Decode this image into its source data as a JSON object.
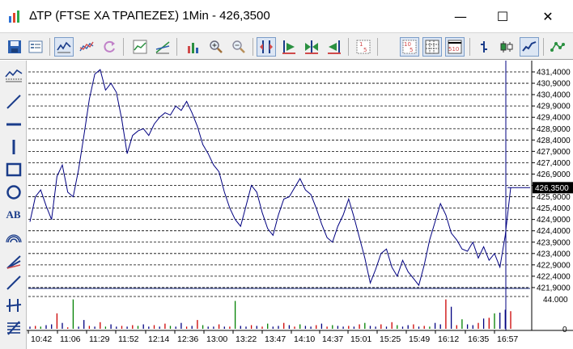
{
  "window": {
    "title": "ΔΤΡ (FTSE ΧΑ ΤΡΑΠΕΖΕΣ) 1Min - 426,3500",
    "minimize_glyph": "—",
    "maximize_glyph": "☐",
    "close_glyph": "✕"
  },
  "toolbar": {
    "buttons": [
      {
        "name": "save-icon",
        "pressed": false
      },
      {
        "name": "list-icon",
        "pressed": false
      },
      {
        "name": "line-chart-toggle-icon",
        "pressed": true
      },
      {
        "name": "refresh-icon",
        "pressed": false
      },
      {
        "name": "chart-type-icon",
        "pressed": false
      },
      {
        "name": "trend-icon",
        "pressed": false
      },
      {
        "name": "bar-volume-icon",
        "pressed": false
      },
      {
        "name": "zoom-in-icon",
        "pressed": false
      },
      {
        "name": "zoom-out-icon",
        "pressed": false
      },
      {
        "name": "crosshair-icon",
        "pressed": true
      },
      {
        "name": "scroll-right-icon",
        "pressed": false
      },
      {
        "name": "scroll-both-icon",
        "pressed": false
      },
      {
        "name": "scroll-left-icon",
        "pressed": false
      },
      {
        "name": "interval-1-icon",
        "pressed": false
      },
      {
        "name": "interval-10-icon",
        "pressed": true
      },
      {
        "name": "grid-icon",
        "pressed": true
      },
      {
        "name": "interval-510-icon",
        "pressed": true
      },
      {
        "name": "bar-style-icon",
        "pressed": false
      },
      {
        "name": "candle-style-icon",
        "pressed": false
      },
      {
        "name": "line-style-icon",
        "pressed": true
      },
      {
        "name": "indicator-icon",
        "pressed": false
      }
    ]
  },
  "sidebar": {
    "tools": [
      "chart-overview-icon",
      "trendline-icon",
      "horizontal-line-icon",
      "vertical-line-icon",
      "rectangle-icon",
      "ellipse-icon",
      "text-tool-icon",
      "arc-icon",
      "fibonacci-fan-icon",
      "channel-icon",
      "speed-lines-icon",
      "fibonacci-retracement-icon"
    ],
    "text_tool_label": "AB"
  },
  "chart_data": {
    "type": "line",
    "title": "",
    "price_axis_labels": [
      "431,4000",
      "430,9000",
      "430,4000",
      "429,9000",
      "429,4000",
      "428,9000",
      "428,4000",
      "427,9000",
      "427,4000",
      "426,9000",
      "426,4000",
      "425,9000",
      "425,4000",
      "424,9000",
      "424,4000",
      "423,9000",
      "423,4000",
      "422,9000",
      "422,4000",
      "421,9000"
    ],
    "volume_axis_labels": [
      "44.000",
      "0"
    ],
    "x_tick_labels": [
      "10:42",
      "11:06",
      "11:29",
      "11:52",
      "12:14",
      "12:36",
      "13:00",
      "13:22",
      "13:47",
      "14:10",
      "14:37",
      "15:01",
      "15:25",
      "15:49",
      "16:12",
      "16:35",
      "16:57"
    ],
    "current_value_label": "426,3500",
    "ylim": [
      421.6,
      431.7
    ],
    "grid": true,
    "series": [
      {
        "values": [
          424.8,
          425.9,
          426.2,
          425.5,
          424.9,
          426.8,
          427.3,
          426.1,
          425.9,
          427.1,
          428.6,
          430.2,
          431.3,
          431.5,
          430.6,
          430.9,
          430.5,
          429.3,
          427.8,
          428.6,
          428.8,
          428.9,
          428.6,
          429.1,
          429.4,
          429.6,
          429.5,
          429.9,
          429.7,
          430.1,
          429.6,
          429.0,
          428.2,
          427.8,
          427.3,
          427.0,
          426.1,
          425.4,
          424.9,
          424.6,
          425.5,
          426.4,
          426.1,
          425.2,
          424.5,
          424.2,
          425.1,
          425.8,
          425.9,
          426.3,
          426.7,
          426.2,
          426.0,
          425.4,
          424.7,
          424.1,
          423.9,
          424.6,
          425.1,
          425.8,
          425.0,
          424.1,
          423.2,
          422.1,
          422.7,
          423.4,
          423.6,
          422.8,
          422.4,
          423.1,
          422.6,
          422.3,
          422.0,
          422.9,
          424.0,
          424.8,
          425.6,
          425.1,
          424.3,
          424.0,
          423.6,
          423.5,
          423.9,
          423.2,
          423.7,
          423.1,
          423.4,
          422.8,
          424.2,
          426.3
        ]
      }
    ],
    "volume_series": {
      "values": [
        3,
        4,
        3,
        5,
        6,
        21,
        8,
        2,
        40,
        3,
        12,
        4,
        3,
        9,
        3,
        6,
        3,
        4,
        3,
        5,
        4,
        6,
        3,
        5,
        3,
        7,
        4,
        3,
        8,
        3,
        4,
        12,
        5,
        3,
        3,
        6,
        3,
        3,
        38,
        4,
        3,
        5,
        4,
        3,
        7,
        3,
        4,
        8,
        5,
        3,
        6,
        4,
        3,
        5,
        7,
        3,
        5,
        4,
        3,
        4,
        3,
        6,
        8,
        4,
        3,
        6,
        3,
        9,
        5,
        3,
        5,
        6,
        3,
        4,
        3,
        8,
        6,
        40,
        30,
        5,
        13,
        6,
        5,
        8,
        14,
        15,
        21,
        22,
        26,
        24
      ]
    }
  }
}
